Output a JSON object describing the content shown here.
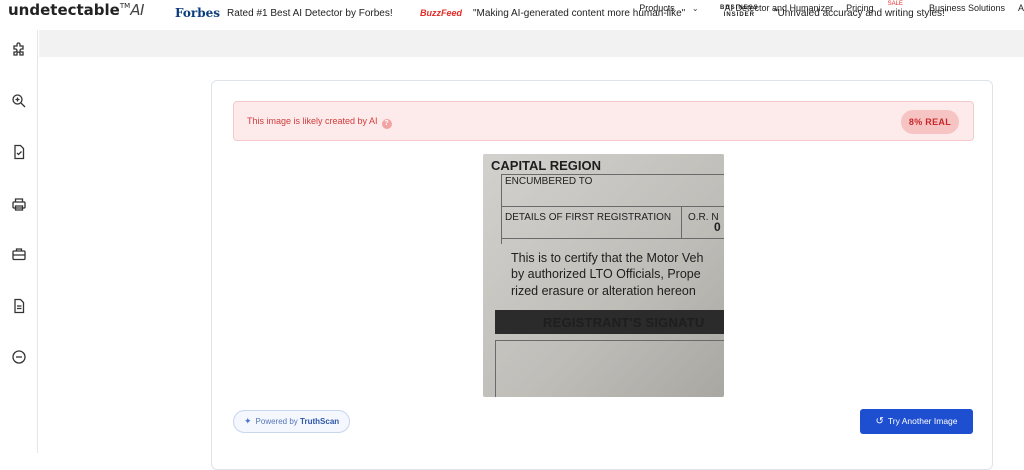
{
  "brand": {
    "name": "undetectable",
    "tm": "TM",
    "suffix": "AI"
  },
  "nav": {
    "products": "Products",
    "detector": "AI Detector and Humanizer",
    "pricing": "Pricing",
    "sale": "SALE",
    "business": "Business Solutions",
    "cut": "A"
  },
  "sidebar": {
    "icons": [
      "puzzle-icon",
      "zoom-search-icon",
      "document-check-icon",
      "printer-icon",
      "briefcase-icon",
      "file-text-icon",
      "minus-circle-icon"
    ]
  },
  "press": {
    "forbes_logo": "Forbes",
    "forbes_quote": "Rated #1 Best AI Detector by Forbes!",
    "buzzfeed_logo": "BuzzFeed",
    "buzzfeed_quote": "\"Making AI-generated content more human-like\"",
    "bi_logo_line1": "BUSINESS",
    "bi_logo_line2": "INSIDER",
    "bi_quote": "\"Unrivaled accuracy and writing styles!\""
  },
  "result": {
    "message": "This image is likely created by AI",
    "info_glyph": "?",
    "badge": "8% REAL",
    "color_bg": "#fdeaea",
    "color_text": "#d23c3c"
  },
  "document": {
    "heading": "CAPITAL REGION",
    "encumbered": "ENCUMBERED TO",
    "details": "DETAILS OF FIRST REGISTRATION",
    "or_label": "O.R. N",
    "digit": "0",
    "line1": "This is to certify that the Motor Veh",
    "line2": "by authorized LTO Officials, Prope",
    "line3": "rized erasure or alteration hereon",
    "signature_bar": "REGISTRANT'S SIGNATU"
  },
  "footer": {
    "powered_prefix": "Powered by",
    "powered_brand": "TruthScan",
    "try_label": "Try Another Image",
    "accent": "#1e4fd1"
  }
}
